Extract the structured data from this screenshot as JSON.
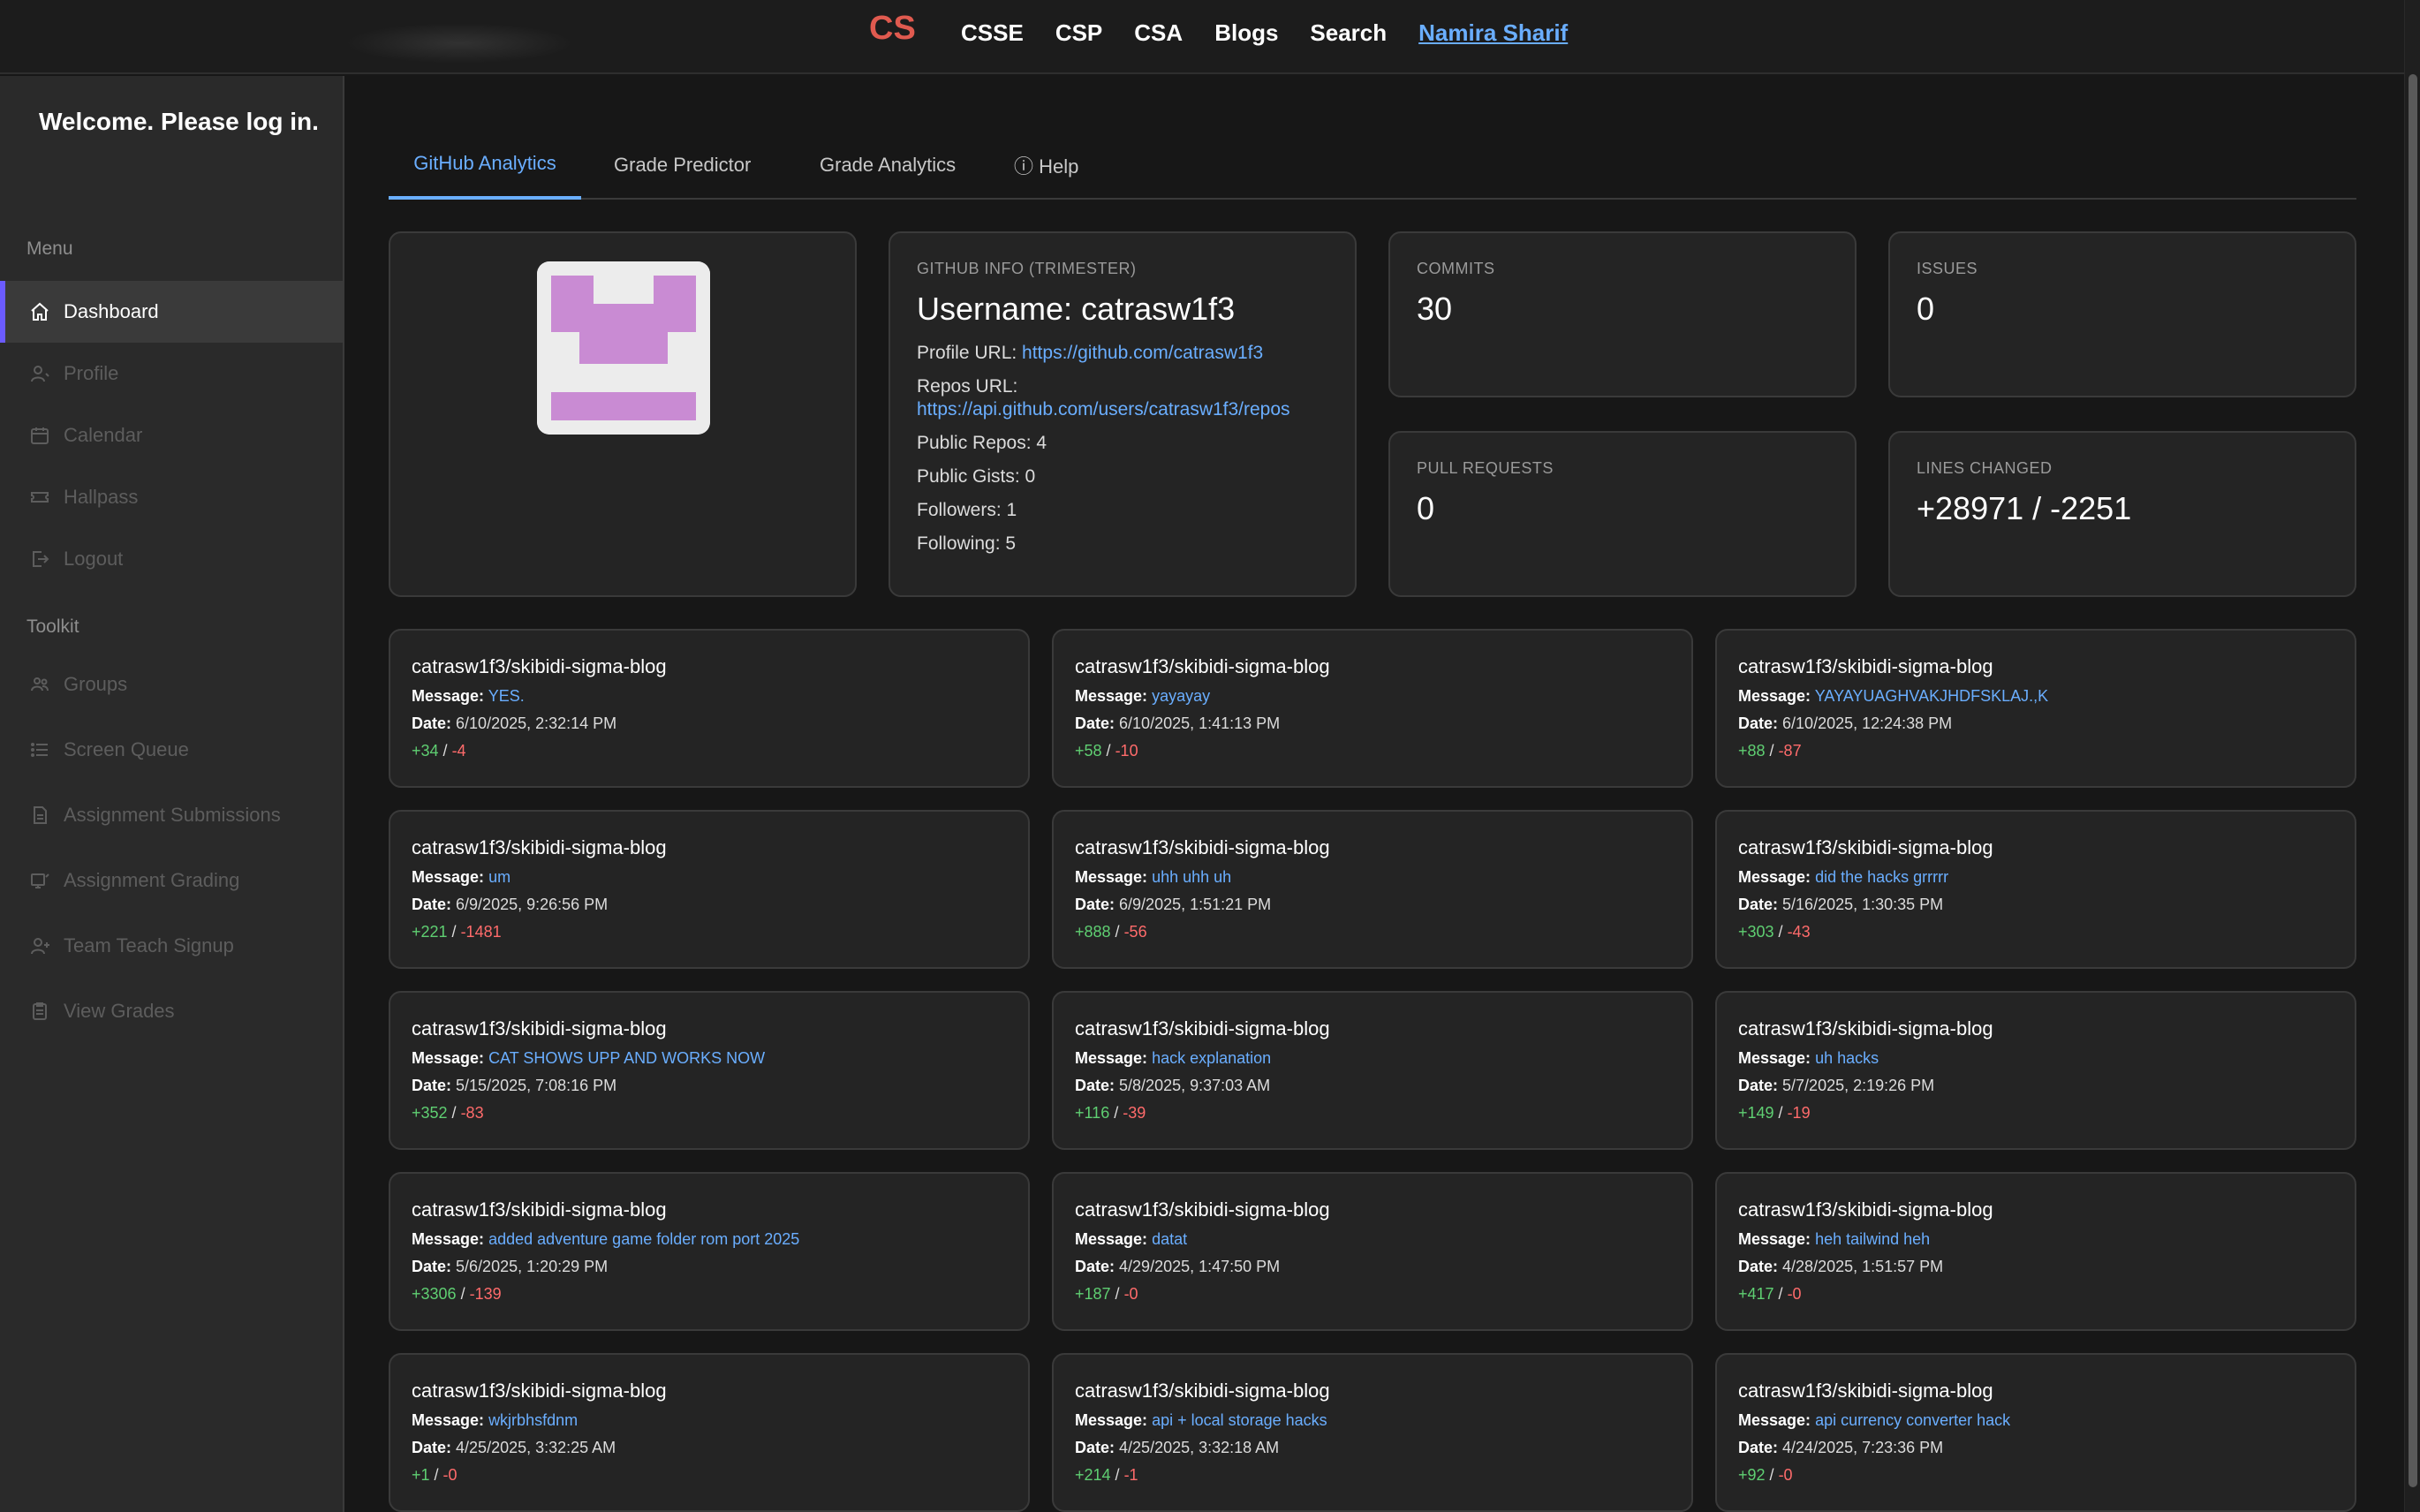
{
  "topbar": {
    "nav": [
      "CSSE",
      "CSP",
      "CSA",
      "Blogs",
      "Search"
    ],
    "user": "Namira Sharif",
    "logo_text": "CS",
    "logo_color": "#e05a4f"
  },
  "sidebar": {
    "welcome": "Welcome. Please log in.",
    "menu_header": "Menu",
    "menu_items": [
      {
        "label": "Dashboard",
        "icon": "home-icon"
      },
      {
        "label": "Profile",
        "icon": "profile-icon"
      },
      {
        "label": "Calendar",
        "icon": "calendar-icon"
      },
      {
        "label": "Hallpass",
        "icon": "ticket-icon"
      },
      {
        "label": "Logout",
        "icon": "logout-icon"
      }
    ],
    "toolkit_header": "Toolkit",
    "toolkit_items": [
      {
        "label": "Groups",
        "icon": "groups-icon"
      },
      {
        "label": "Screen Queue",
        "icon": "queue-icon"
      },
      {
        "label": "Assignment Submissions",
        "icon": "submissions-icon"
      },
      {
        "label": "Assignment Grading",
        "icon": "grading-icon"
      },
      {
        "label": "Team Teach Signup",
        "icon": "signup-icon"
      },
      {
        "label": "View Grades",
        "icon": "grades-icon"
      }
    ]
  },
  "tabs": [
    "GitHub Analytics",
    "Grade Predictor",
    "Grade Analytics",
    "ⓘ Help"
  ],
  "info": {
    "header": "GITHUB INFO (TRIMESTER)",
    "username": "Username: catrasw1f3",
    "profile_url_label": "Profile URL:",
    "profile_url": "https://github.com/catrasw1f3",
    "repos_url_label": "Repos URL:",
    "repos_url": "https://api.github.com/users/catrasw1f3/repos",
    "public_repos": "Public Repos: 4",
    "public_gists": "Public Gists: 0",
    "followers": "Followers: 1",
    "following": "Following: 5"
  },
  "stats": {
    "commits_label": "COMMITS",
    "commits": "30",
    "issues_label": "ISSUES",
    "issues": "0",
    "prs_label": "PULL REQUESTS",
    "prs": "0",
    "lines_label": "LINES CHANGED",
    "lines": "+28971 / -2251"
  },
  "labels": {
    "message": "Message:",
    "date": "Date:"
  },
  "commits": [
    {
      "repo": "catrasw1f3/skibidi-sigma-blog",
      "message": "YES.",
      "date": "6/10/2025, 2:32:14 PM",
      "add": "+34",
      "del": "-4"
    },
    {
      "repo": "catrasw1f3/skibidi-sigma-blog",
      "message": "yayayay",
      "date": "6/10/2025, 1:41:13 PM",
      "add": "+58",
      "del": "-10"
    },
    {
      "repo": "catrasw1f3/skibidi-sigma-blog",
      "message": "YAYAYUAGHVAKJHDFSKLAJ.,K",
      "date": "6/10/2025, 12:24:38 PM",
      "add": "+88",
      "del": "-87"
    },
    {
      "repo": "catrasw1f3/skibidi-sigma-blog",
      "message": "um",
      "date": "6/9/2025, 9:26:56 PM",
      "add": "+221",
      "del": "-1481"
    },
    {
      "repo": "catrasw1f3/skibidi-sigma-blog",
      "message": "uhh uhh uh",
      "date": "6/9/2025, 1:51:21 PM",
      "add": "+888",
      "del": "-56"
    },
    {
      "repo": "catrasw1f3/skibidi-sigma-blog",
      "message": "did the hacks grrrrr",
      "date": "5/16/2025, 1:30:35 PM",
      "add": "+303",
      "del": "-43"
    },
    {
      "repo": "catrasw1f3/skibidi-sigma-blog",
      "message": "CAT SHOWS UPP AND WORKS NOW",
      "date": "5/15/2025, 7:08:16 PM",
      "add": "+352",
      "del": "-83"
    },
    {
      "repo": "catrasw1f3/skibidi-sigma-blog",
      "message": "hack explanation",
      "date": "5/8/2025, 9:37:03 AM",
      "add": "+116",
      "del": "-39"
    },
    {
      "repo": "catrasw1f3/skibidi-sigma-blog",
      "message": "uh hacks",
      "date": "5/7/2025, 2:19:26 PM",
      "add": "+149",
      "del": "-19"
    },
    {
      "repo": "catrasw1f3/skibidi-sigma-blog",
      "message": "added adventure game folder rom port 2025",
      "date": "5/6/2025, 1:20:29 PM",
      "add": "+3306",
      "del": "-139"
    },
    {
      "repo": "catrasw1f3/skibidi-sigma-blog",
      "message": "datat",
      "date": "4/29/2025, 1:47:50 PM",
      "add": "+187",
      "del": "-0"
    },
    {
      "repo": "catrasw1f3/skibidi-sigma-blog",
      "message": "heh tailwind heh",
      "date": "4/28/2025, 1:51:57 PM",
      "add": "+417",
      "del": "-0"
    },
    {
      "repo": "catrasw1f3/skibidi-sigma-blog",
      "message": "wkjrbhsfdnm",
      "date": "4/25/2025, 3:32:25 AM",
      "add": "+1",
      "del": "-0"
    },
    {
      "repo": "catrasw1f3/skibidi-sigma-blog",
      "message": "api + local storage hacks",
      "date": "4/25/2025, 3:32:18 AM",
      "add": "+214",
      "del": "-1"
    },
    {
      "repo": "catrasw1f3/skibidi-sigma-blog",
      "message": "api currency converter hack",
      "date": "4/24/2025, 7:23:36 PM",
      "add": "+92",
      "del": "-0"
    }
  ],
  "colors": {
    "accent": "#6aaeff",
    "active_marker": "#6b5bff",
    "additions": "#5fcf72",
    "deletions": "#ff6b6b",
    "identicon": "#c98bd3"
  }
}
